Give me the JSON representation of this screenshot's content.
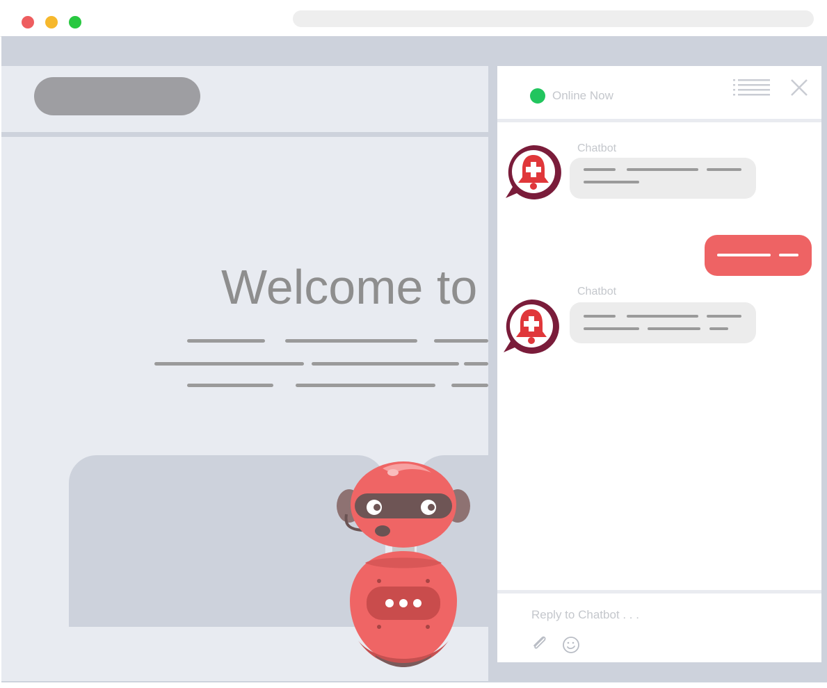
{
  "window": {
    "controls": [
      "close",
      "minimize",
      "maximize"
    ],
    "colors": {
      "close": "#ee5d5f",
      "minimize": "#f6b82c",
      "maximize": "#28c840"
    }
  },
  "website": {
    "hero_title": "Welcome to"
  },
  "chat": {
    "status_text": "Online Now",
    "status_color": "#22c55e",
    "menu_icon": "list-icon",
    "close_icon": "close-icon",
    "messages": [
      {
        "sender": "Chatbot",
        "type": "bot"
      },
      {
        "type": "user"
      },
      {
        "sender": "Chatbot",
        "type": "bot"
      }
    ],
    "reply_placeholder": "Reply to Chatbot . . .",
    "attach_icon": "paperclip-icon",
    "emoji_icon": "smiley-icon",
    "accent_color": "#ee6364"
  }
}
